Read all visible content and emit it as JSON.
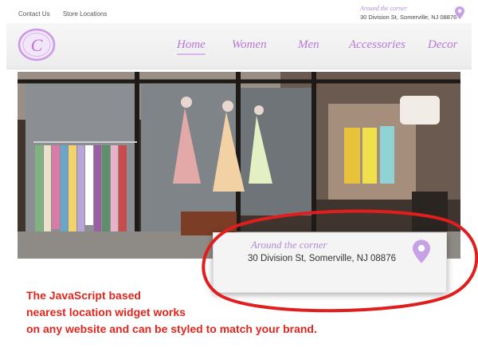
{
  "top_links": {
    "contact": "Contact Us",
    "store_locations": "Store Locations"
  },
  "header_widget": {
    "tagline": "Around the corner",
    "address": "30 Division St, Somerville, NJ 08876"
  },
  "logo": {
    "letter": "C"
  },
  "nav": {
    "home": "Home",
    "women": "Women",
    "men": "Men",
    "accessories": "Accessories",
    "decor": "Decor"
  },
  "callout": {
    "tagline": "Around the corner",
    "address": "30 Division St, Somerville, NJ 08876"
  },
  "caption": {
    "line1": "The JavaScript based",
    "line2": "nearest location widget works",
    "line3": "on any website and can be styled to match your brand."
  },
  "colors": {
    "accent": "#b877d9",
    "caption": "#e0261d",
    "ring": "#e01e1e"
  },
  "icons": {
    "pin": "map-pin-icon"
  }
}
